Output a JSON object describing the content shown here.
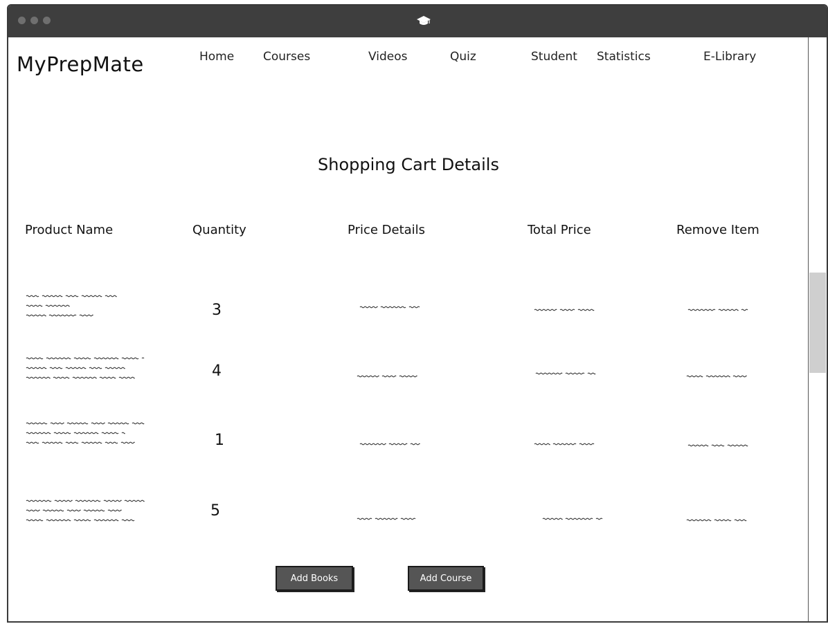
{
  "app": {
    "logo": "MyPrepMate"
  },
  "nav": {
    "items": [
      {
        "label": "Home"
      },
      {
        "label": "Courses"
      },
      {
        "label": "Videos"
      },
      {
        "label": "Quiz"
      },
      {
        "label": "Student"
      },
      {
        "label": "Statistics"
      },
      {
        "label": "E-Library"
      }
    ]
  },
  "page": {
    "title": "Shopping Cart Details"
  },
  "table": {
    "columns": [
      "Product Name",
      "Quantity",
      "Price Details",
      "Total Price",
      "Remove Item"
    ],
    "rows": [
      {
        "quantity": "3"
      },
      {
        "quantity": "4"
      },
      {
        "quantity": "1"
      },
      {
        "quantity": "5"
      }
    ]
  },
  "actions": {
    "add_books": "Add Books",
    "add_course": "Add Course"
  },
  "colors": {
    "titlebar": "#3e3e3e",
    "button": "#555555",
    "scroll_thumb": "#cfcfcf"
  },
  "icons": {
    "titlebar": "graduation-cap-icon"
  }
}
